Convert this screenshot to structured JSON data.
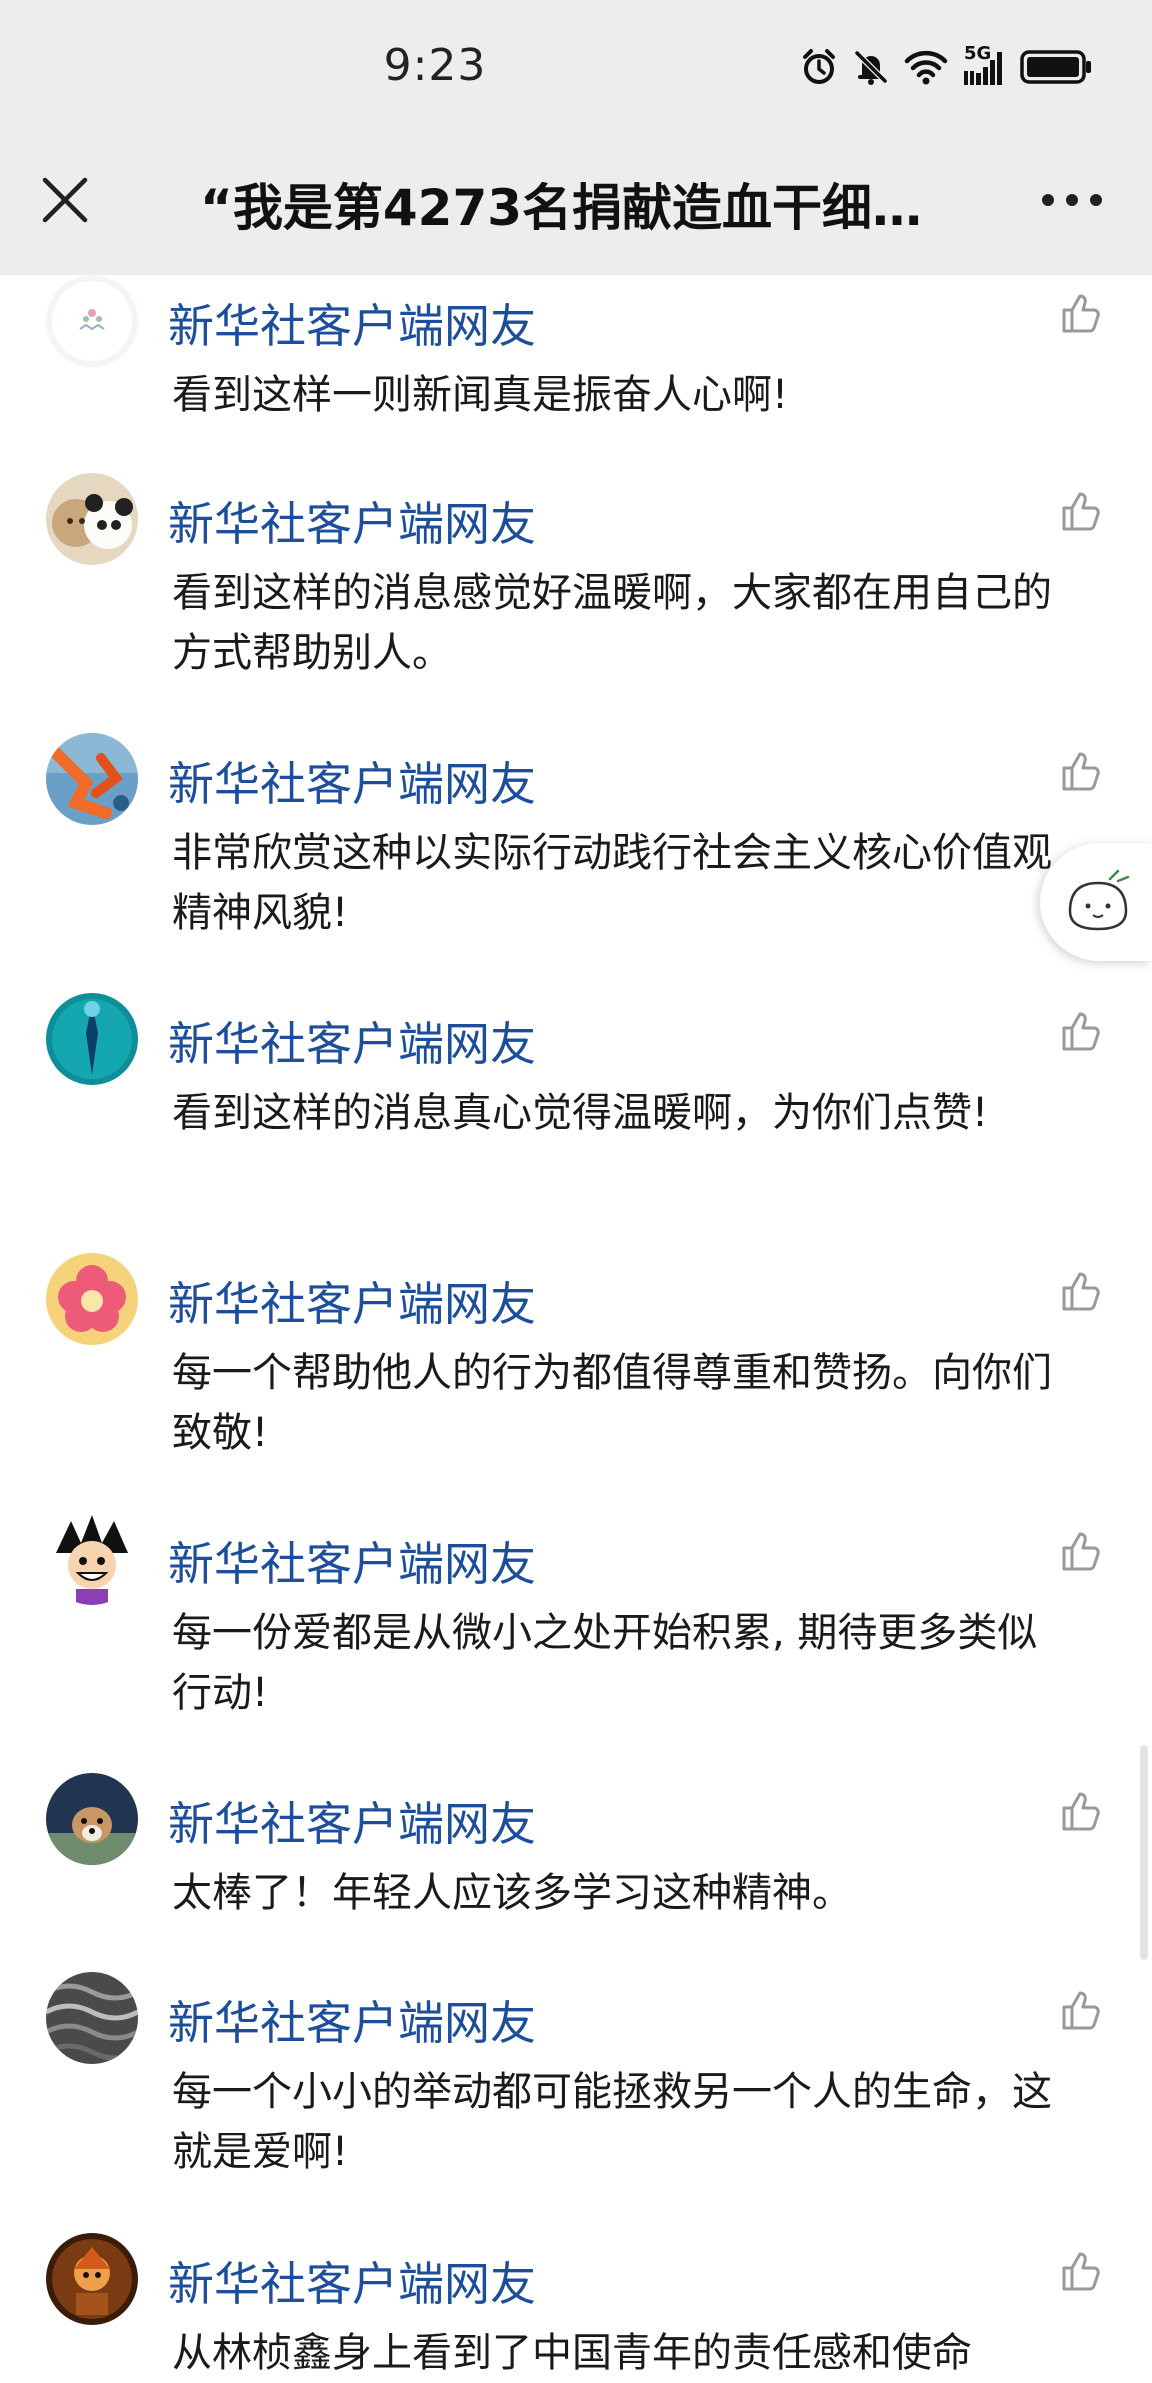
{
  "status_bar": {
    "time": "9:23",
    "network": "5G",
    "icons": [
      "alarm-icon",
      "mute-icon",
      "wifi-icon",
      "signal-icon",
      "battery-icon"
    ]
  },
  "header": {
    "title": "“我是第4273名捐献造血干细…",
    "close_icon": "close-icon",
    "more_icon": "more-icon"
  },
  "comments": [
    {
      "user": "新华社客户端网友",
      "text": "看到这样一则新闻真是振奋人心啊!",
      "avatar": "avatar-flower-white"
    },
    {
      "user": "新华社客户端网友",
      "text": "看到这样的消息感觉好温暖啊，大家都在用自己的方式帮助别人。",
      "avatar": "avatar-bears"
    },
    {
      "user": "新华社客户端网友",
      "text": "非常欣赏这种以实际行动践行社会主义核心价值观精神风貌!",
      "avatar": "avatar-orange-abstract"
    },
    {
      "user": "新华社客户端网友",
      "text": "看到这样的消息真心觉得温暖啊，为你们点赞!",
      "avatar": "avatar-teal"
    },
    {
      "user": "新华社客户端网友",
      "text": "每一个帮助他人的行为都值得尊重和赞扬。向你们致敬!",
      "avatar": "avatar-pink-flower"
    },
    {
      "user": "新华社客户端网友",
      "text": "每一份爱都是从微小之处开始积累, 期待更多类似行动!",
      "avatar": "avatar-cartoon-boy"
    },
    {
      "user": "新华社客户端网友",
      "text": "太棒了！年轻人应该多学习这种精神。",
      "avatar": "avatar-dog"
    },
    {
      "user": "新华社客户端网友",
      "text": "每一个小小的举动都可能拯救另一个人的生命，这就是爱啊!",
      "avatar": "avatar-waves"
    },
    {
      "user": "新华社客户端网友",
      "text": "从林桢鑫身上看到了中国青年的责任感和使命",
      "avatar": "avatar-figure"
    }
  ],
  "colors": {
    "header_bg": "#ededed",
    "username": "#1c4e9b",
    "text": "#1a1a1a"
  }
}
